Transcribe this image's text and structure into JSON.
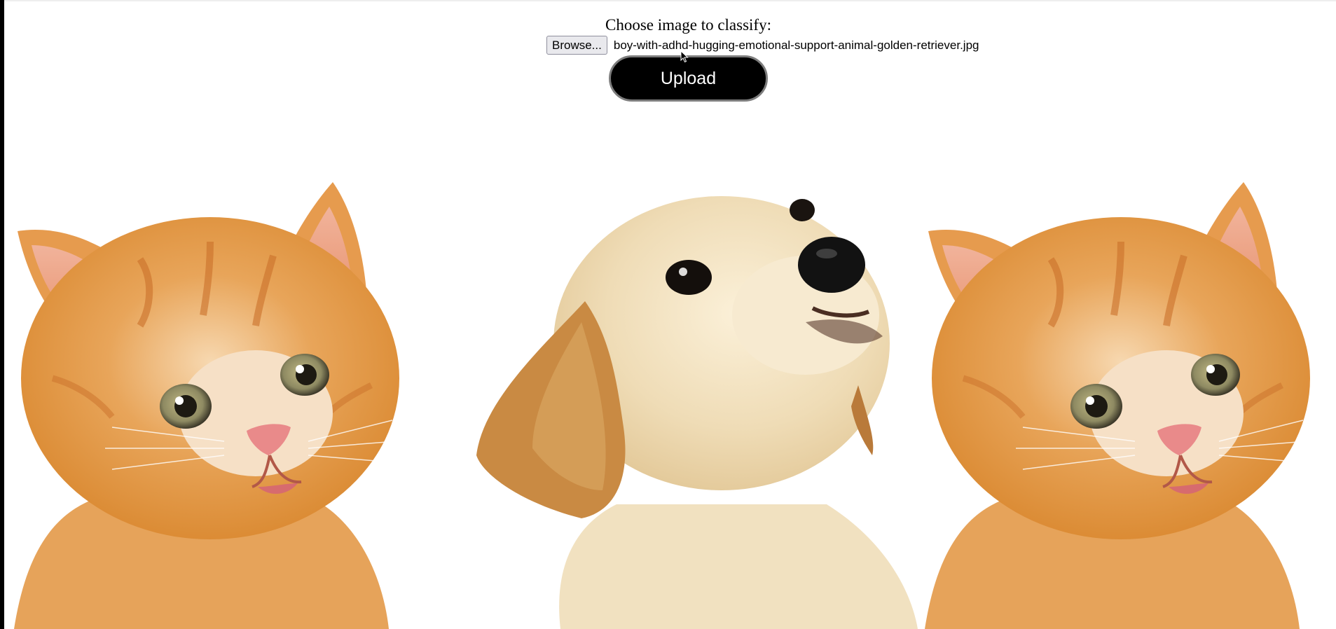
{
  "prompt": "Choose image to classify:",
  "file_input": {
    "button_label": "Browse...",
    "selected_file": "boy-with-adhd-hugging-emotional-support-animal-golden-retriever.jpg"
  },
  "upload_button": {
    "label": "Upload"
  },
  "image": {
    "subjects": [
      "orange-kitten",
      "golden-puppy",
      "orange-kitten"
    ]
  },
  "colors": {
    "kitten_fur": "#e39a45",
    "puppy_fur": "#f0dcb5",
    "puppy_ear": "#c98a43",
    "button_bg": "#000000"
  }
}
